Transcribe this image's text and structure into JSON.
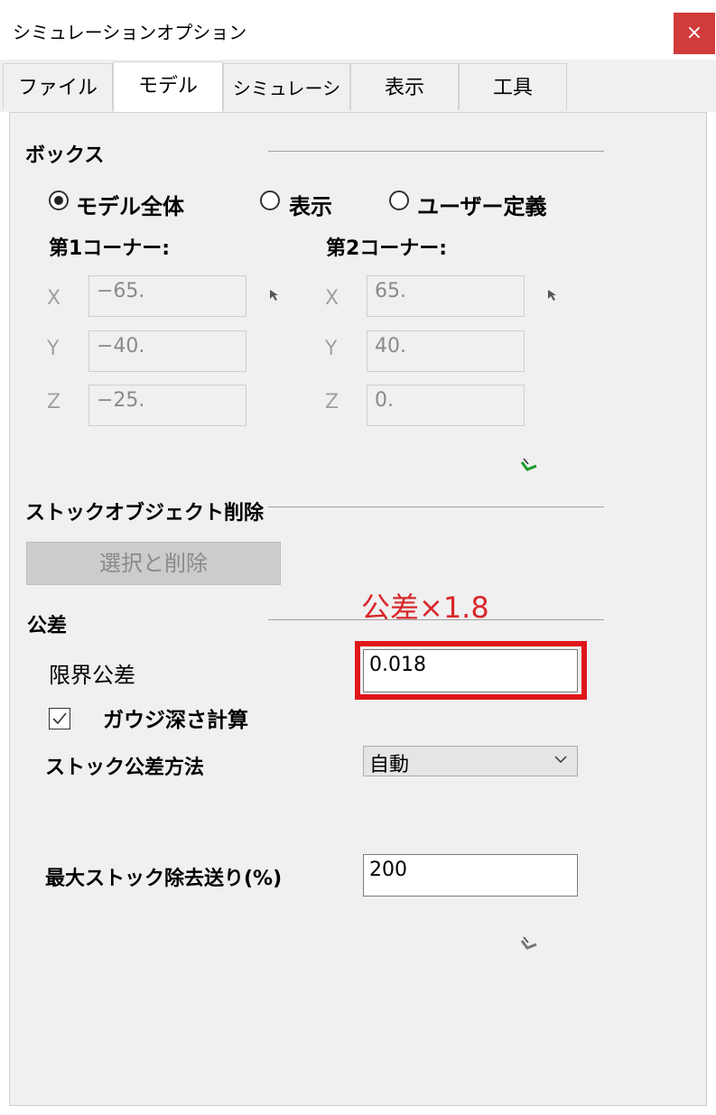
{
  "window": {
    "title": "シミュレーションオプション",
    "close_symbol": "×"
  },
  "tabs": [
    {
      "label": "ファイル",
      "active": false
    },
    {
      "label": "モデル",
      "active": true
    },
    {
      "label": "シミュレーション",
      "active": false
    },
    {
      "label": "表示",
      "active": false
    },
    {
      "label": "工具",
      "active": false
    }
  ],
  "box": {
    "heading": "ボックス",
    "options": [
      "モデル全体",
      "表示",
      "ユーザー定義"
    ],
    "selected": "モデル全体",
    "corner1": {
      "label": "第1コーナー:",
      "x": "−65.",
      "y": "−40.",
      "z": "−25."
    },
    "corner2": {
      "label": "第2コーナー:",
      "x": "65.",
      "y": "40.",
      "z": "0."
    },
    "axis_labels": [
      "X",
      "Y",
      "Z"
    ]
  },
  "stock_delete": {
    "heading": "ストックオブジェクト削除",
    "button_label": "選択と削除"
  },
  "tolerance": {
    "heading": "公差",
    "annotation": "公差×1.8",
    "limit_label": "限界公差",
    "limit_value": "0.018",
    "gouge_label": "ガウジ深さ計算",
    "gouge_checked": true,
    "stock_method_label": "ストック公差方法",
    "stock_method_value": "自動",
    "max_feed_label": "最大ストック除去送り(%)",
    "max_feed_value": "200"
  },
  "colors": {
    "close": "#d13b3b",
    "highlight": "#e0161b",
    "annotation": "#d8282b",
    "accent_green": "#1a9a2a"
  },
  "icons": [
    "close-icon",
    "pick-arrow-icon",
    "apply-check-icon",
    "checkbox-check-icon",
    "chevron-down-icon"
  ]
}
